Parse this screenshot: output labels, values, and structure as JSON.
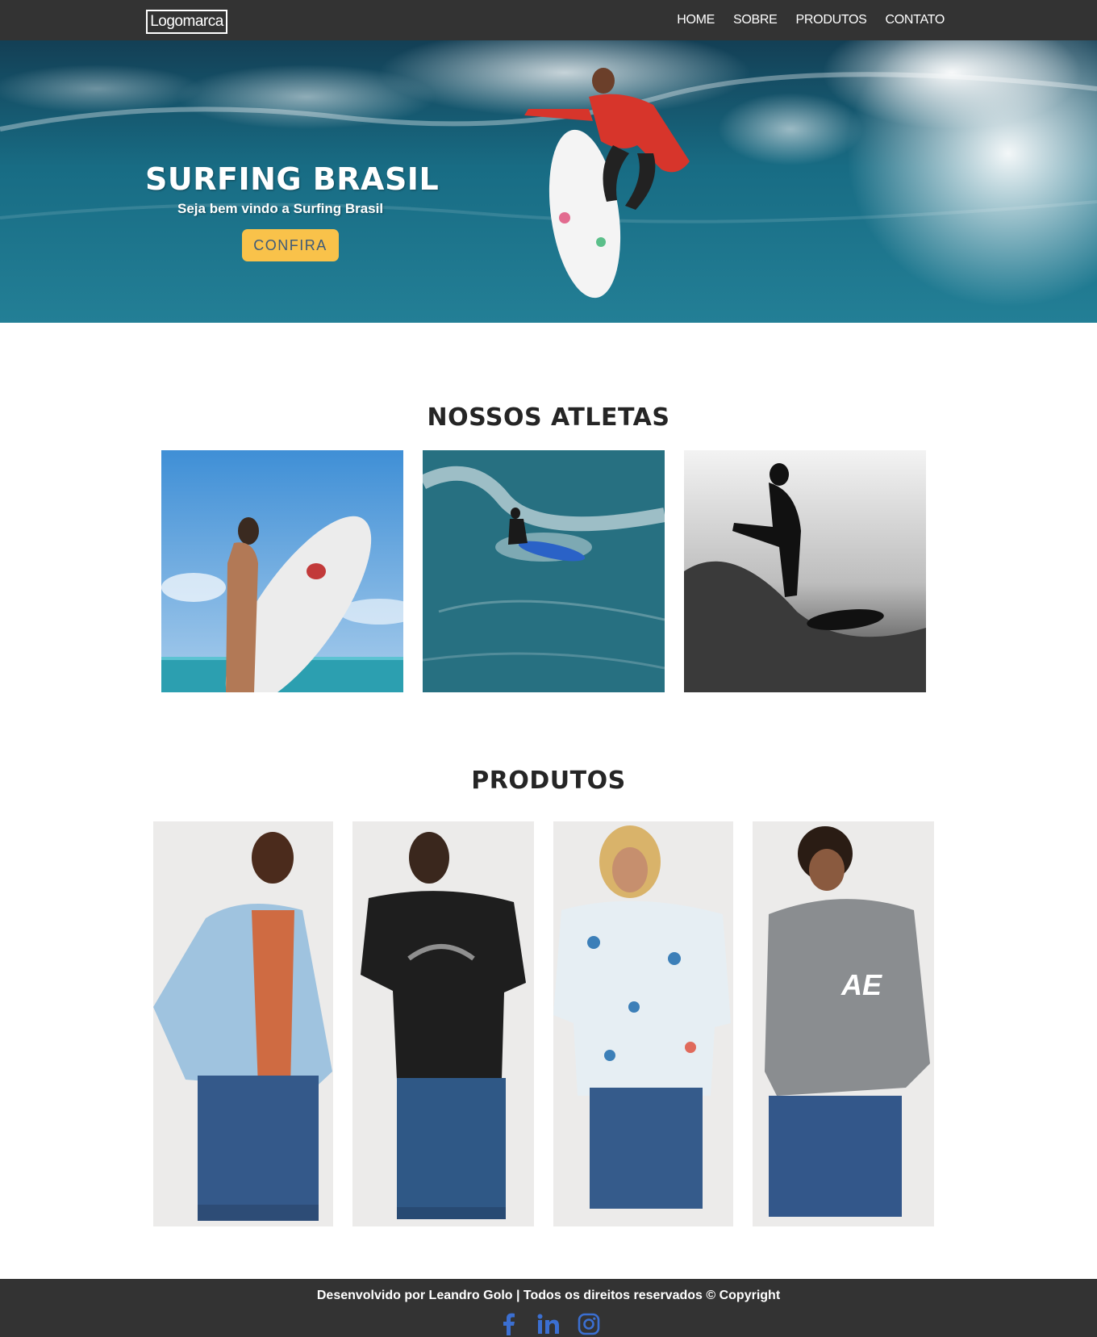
{
  "navbar": {
    "logo": "Logomarca",
    "links": [
      {
        "label": "HOME"
      },
      {
        "label": "SOBRE"
      },
      {
        "label": "PRODUTOS"
      },
      {
        "label": "CONTATO"
      }
    ]
  },
  "hero": {
    "title": "SURFING BRASIL",
    "subtitle": "Seja bem vindo a Surfing Brasil",
    "button_label": "CONFIRA"
  },
  "athletes": {
    "title": "NOSSOS ATLETAS"
  },
  "products": {
    "title": "PRODUTOS"
  },
  "footer": {
    "text": "Desenvolvido por Leandro Golo | Todos os direitos reservados © Copyright",
    "social": [
      "facebook-icon",
      "linkedin-icon",
      "instagram-icon"
    ]
  },
  "colors": {
    "nav_bg": "#333333",
    "accent": "#f9c24a",
    "social_icon": "#3b6fd1"
  }
}
